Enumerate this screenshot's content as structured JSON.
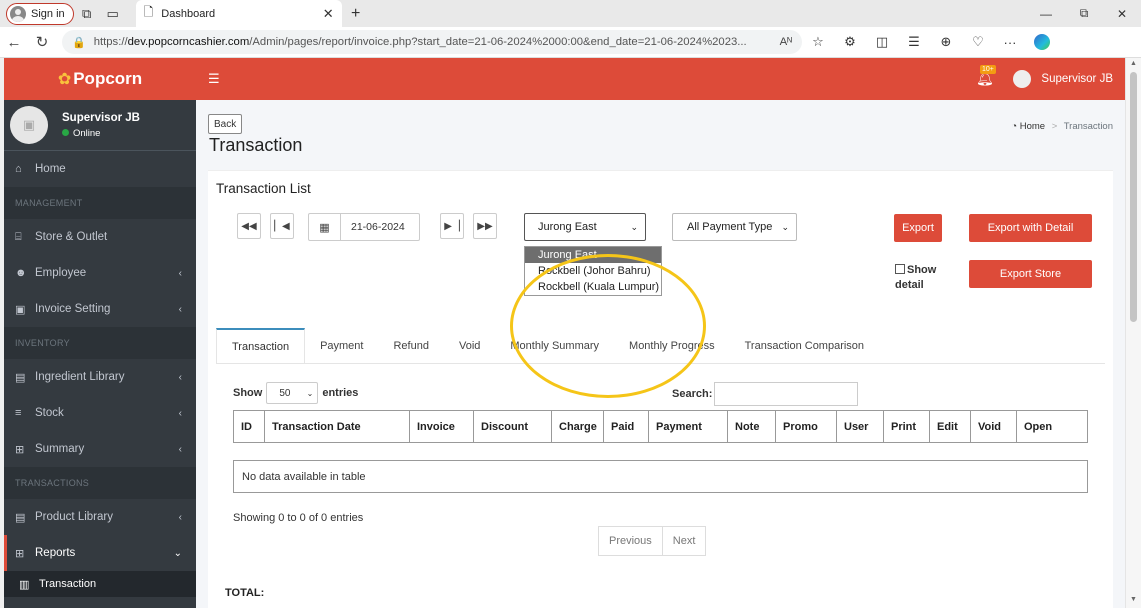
{
  "browser": {
    "signin_label": "Sign in",
    "tab_title": "Dashboard",
    "url_prefix": "https://",
    "url_host": "dev.popcorncashier.com",
    "url_path": "/Admin/pages/report/invoice.php?start_date=21-06-2024%2000:00&end_date=21-06-2024%2023...",
    "read_aloud": "Aᴺ"
  },
  "brand": {
    "name": "Popcorn",
    "color": "#dd4b39"
  },
  "user": {
    "name": "Supervisor JB",
    "status": "Online"
  },
  "sidebar": {
    "home": "Home",
    "management_header": "MANAGEMENT",
    "store_outlet": "Store & Outlet",
    "employee": "Employee",
    "invoice_setting": "Invoice Setting",
    "inventory_header": "INVENTORY",
    "ingredient_library": "Ingredient Library",
    "stock": "Stock",
    "summary": "Summary",
    "transactions_header": "TRANSACTIONS",
    "product_library": "Product Library",
    "reports": "Reports",
    "transaction_sub": "Transaction"
  },
  "topbar": {
    "notif_badge": "10+",
    "user_name": "Supervisor JB"
  },
  "page": {
    "back_label": "Back",
    "title": "Transaction",
    "breadcrumb_home": "Home",
    "breadcrumb_sep": ">",
    "breadcrumb_current": "Transaction"
  },
  "card": {
    "title": "Transaction List",
    "date_value": "21-06-2024",
    "outlet_selected": "Jurong East",
    "outlet_options": [
      "Jurong East",
      "Rockbell (Johor Bahru)",
      "Rockbell (Kuala Lumpur)"
    ],
    "payment_type": "All Payment Type",
    "export_label": "Export",
    "export_detail_label": "Export with Detail",
    "export_store_label": "Export Store",
    "show_detail_line1": "Show",
    "show_detail_line2": "detail"
  },
  "tabs": [
    "Transaction",
    "Payment",
    "Refund",
    "Void",
    "Monthly Summary",
    "Monthly Progress",
    "Transaction Comparison"
  ],
  "table": {
    "show_label": "Show",
    "entries_value": "50",
    "entries_label": "entries",
    "search_label": "Search:",
    "columns": [
      "ID",
      "Transaction Date",
      "Invoice",
      "Discount",
      "Charge",
      "Paid",
      "Payment",
      "Note",
      "Promo",
      "User",
      "Print",
      "Edit",
      "Void",
      "Open"
    ],
    "empty_text": "No data available in table",
    "info_text": "Showing 0 to 0 of 0 entries",
    "prev_label": "Previous",
    "next_label": "Next"
  },
  "total_label": "TOTAL:"
}
